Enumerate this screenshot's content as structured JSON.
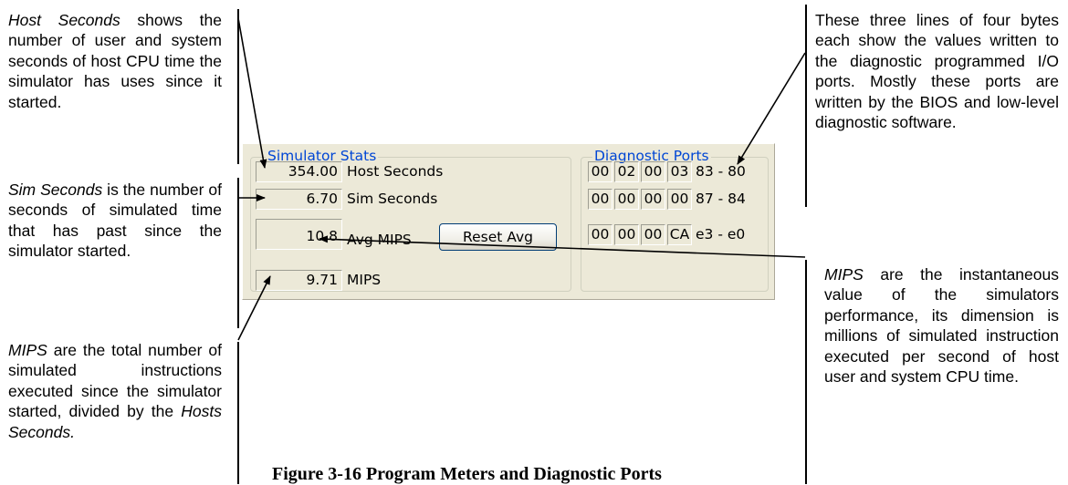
{
  "notes": {
    "host_seconds": {
      "term": "Host Seconds",
      "text": " shows the number of user and system seconds of host CPU time the simulator has uses since it started."
    },
    "sim_seconds": {
      "term": "Sim Seconds",
      "text": " is the number of seconds of simulated time that has past since the simulator started."
    },
    "mips_total": {
      "term": "MIPS",
      "text": " are the total number of simulated instructions executed since the simulator started, divided by the ",
      "term2": "Hosts Seconds."
    },
    "diag_ports": {
      "text": "These three lines of four bytes each show the values written to the diagnostic programmed I/O ports. Mostly these ports are written by the BIOS and low-level diagnostic software."
    },
    "mips_inst": {
      "term": "MIPS",
      "text": " are the instantaneous value of the simulators performance, its dimension is millions of simulated instruction executed per second of host user and system CPU time."
    }
  },
  "panel": {
    "stats_title": "Simulator Stats",
    "stats": [
      {
        "value": "354.00",
        "label": "Host Seconds"
      },
      {
        "value": "6.70",
        "label": "Sim Seconds"
      },
      {
        "value": "10.8",
        "label": "Avg MIPS"
      },
      {
        "value": "9.71",
        "label": "MIPS"
      }
    ],
    "reset_button": "Reset Avg",
    "ports_title": "Diagnostic Ports",
    "ports": [
      {
        "bytes": [
          "00",
          "02",
          "00",
          "03"
        ],
        "range": "83 - 80"
      },
      {
        "bytes": [
          "00",
          "00",
          "00",
          "00"
        ],
        "range": "87 - 84"
      },
      {
        "bytes": [
          "00",
          "00",
          "00",
          "CA"
        ],
        "range": "e3 - e0"
      }
    ]
  },
  "caption": "Figure 3-16  Program Meters and Diagnostic Ports"
}
